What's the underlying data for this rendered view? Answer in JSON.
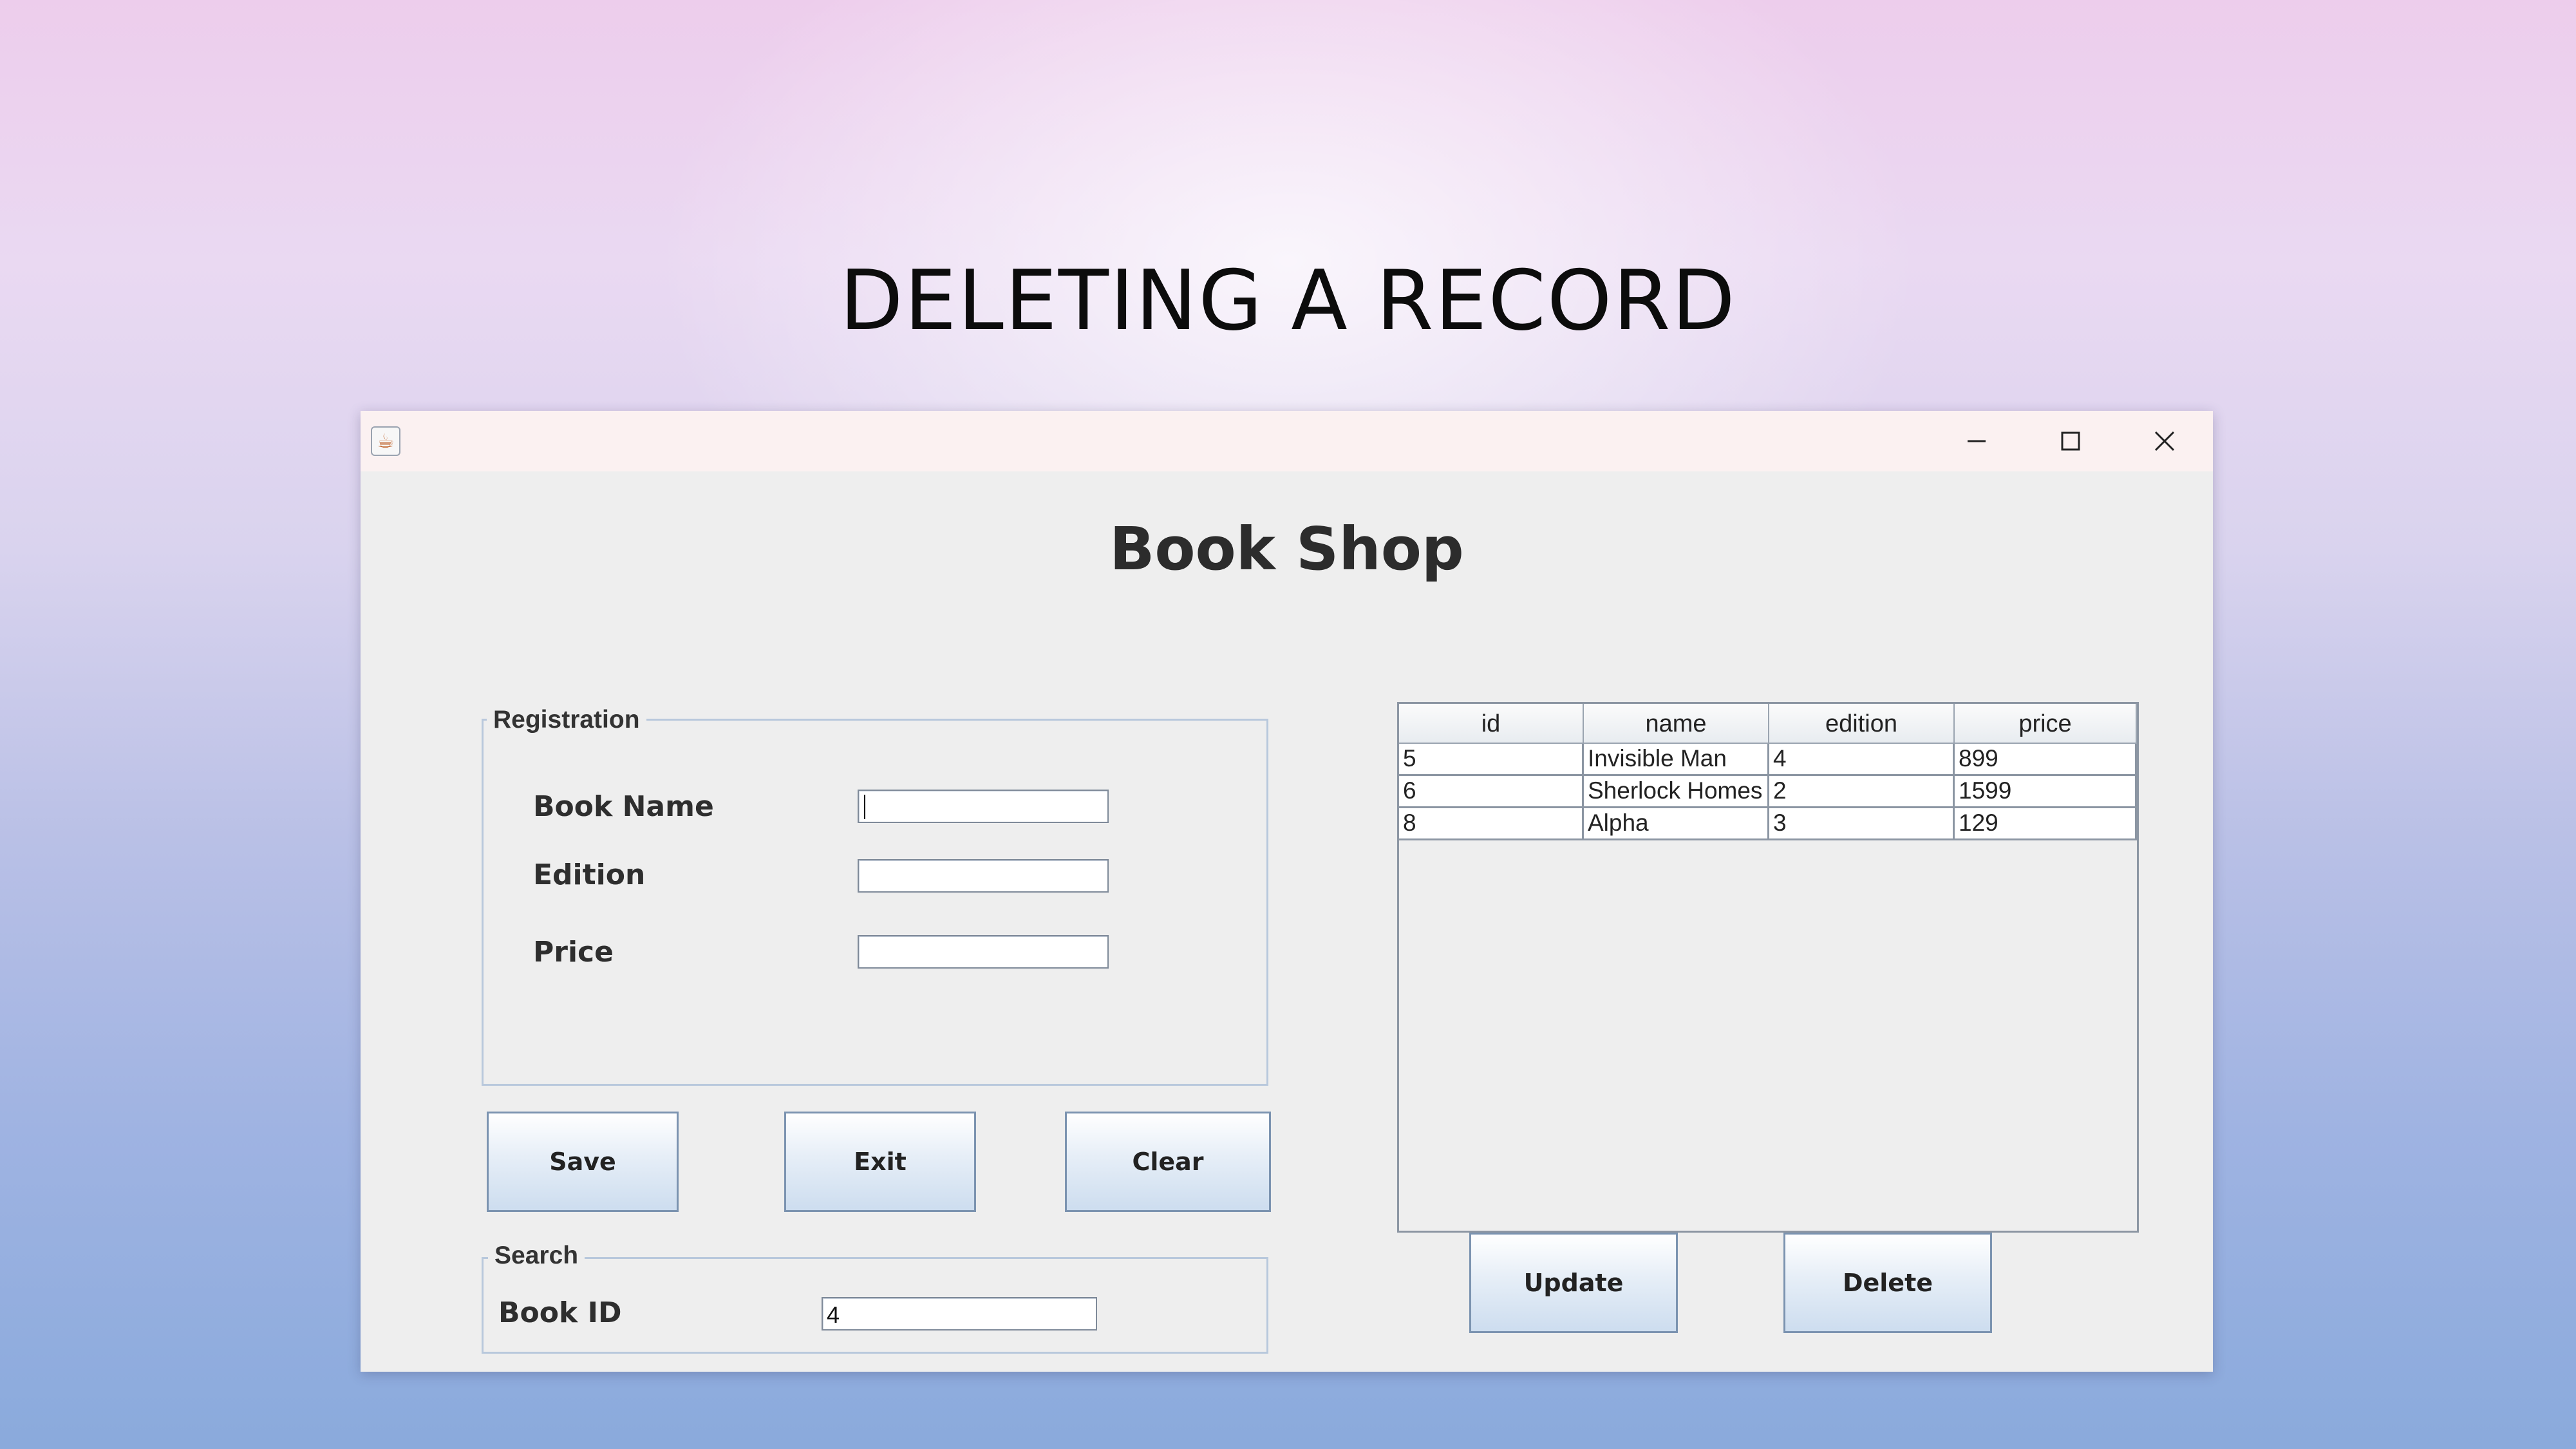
{
  "slide": {
    "title": "DELETING A RECORD"
  },
  "window": {
    "icon": "java-cup-icon",
    "controls": {
      "minimize": "minimize-icon",
      "maximize": "maximize-icon",
      "close": "close-icon"
    }
  },
  "app": {
    "title": "Book Shop"
  },
  "registration": {
    "legend": "Registration",
    "book_name_label": "Book Name",
    "book_name_value": "",
    "edition_label": "Edition",
    "edition_value": "",
    "price_label": "Price",
    "price_value": ""
  },
  "buttons": {
    "save": "Save",
    "exit": "Exit",
    "clear": "Clear",
    "update": "Update",
    "delete": "Delete"
  },
  "search": {
    "legend": "Search",
    "book_id_label": "Book ID",
    "book_id_value": "4"
  },
  "table": {
    "columns": [
      "id",
      "name",
      "edition",
      "price"
    ],
    "rows": [
      [
        "5",
        "Invisible Man",
        "4",
        "899"
      ],
      [
        "6",
        "Sherlock Homes",
        "2",
        "1599"
      ],
      [
        "8",
        "Alpha",
        "3",
        "129"
      ]
    ]
  },
  "colors": {
    "button_border": "#7b93b0",
    "group_border": "#b8c8dc",
    "window_bg": "#eeeeee"
  }
}
